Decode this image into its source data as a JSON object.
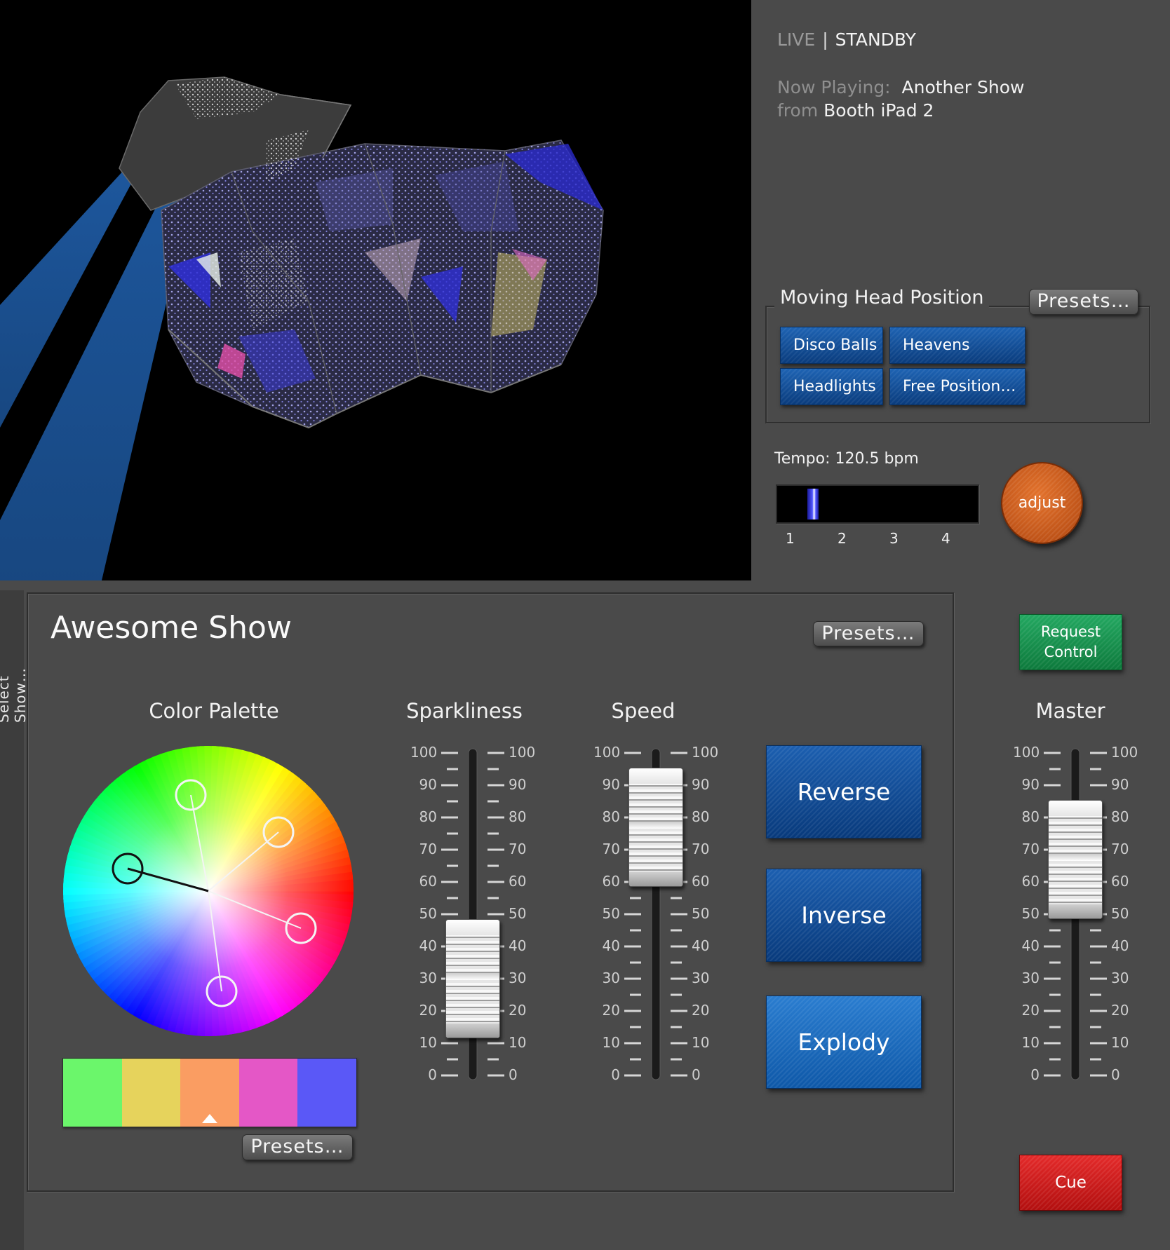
{
  "status": {
    "live": "LIVE",
    "separator": "|",
    "standby": "STANDBY"
  },
  "now_playing": {
    "label": "Now Playing:",
    "show": "Another Show",
    "from_label": "from",
    "source": "Booth iPad 2"
  },
  "moving_head": {
    "title": "Moving Head Position",
    "presets_label": "Presets…",
    "buttons": [
      "Disco Balls",
      "Heavens",
      "Headlights",
      "Free Position…"
    ]
  },
  "tempo": {
    "label": "Tempo: 120.5 bpm",
    "beats": [
      "1",
      "2",
      "3",
      "4"
    ],
    "position": 0.18,
    "adjust_label": "adjust"
  },
  "sidebar": {
    "select_show_label": "Select Show…"
  },
  "show": {
    "title": "Awesome Show",
    "presets_label": "Presets…",
    "color_palette": {
      "label": "Color Palette",
      "presets_label": "Presets…",
      "swatches": [
        "#6bf66b",
        "#e6d35c",
        "#fa9d62",
        "#e457c6",
        "#5a58f7"
      ],
      "selected_swatch": 2
    },
    "faders": [
      {
        "label": "Sparkliness",
        "value": 30
      },
      {
        "label": "Speed",
        "value": 77
      },
      {
        "label": "Master",
        "value": 67
      }
    ],
    "fader_scale": [
      "100",
      "90",
      "80",
      "70",
      "60",
      "50",
      "40",
      "30",
      "20",
      "10",
      "0"
    ],
    "effect_buttons": [
      "Reverse",
      "Inverse",
      "Explody"
    ]
  },
  "control": {
    "request_label_1": "Request",
    "request_label_2": "Control",
    "cue_label": "Cue"
  },
  "colors": {
    "accent_blue": "#0e4c98",
    "request_green": "#17924d",
    "cue_red": "#cc1c1c",
    "adjust_orange": "#cf5a1c"
  }
}
